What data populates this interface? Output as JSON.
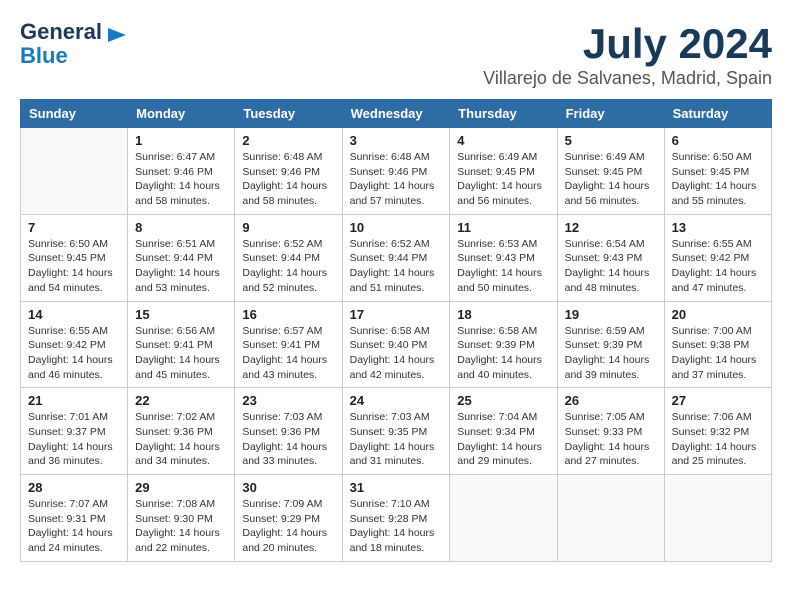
{
  "header": {
    "logo_line1": "General",
    "logo_line2": "Blue",
    "month": "July 2024",
    "location": "Villarejo de Salvanes, Madrid, Spain"
  },
  "weekdays": [
    "Sunday",
    "Monday",
    "Tuesday",
    "Wednesday",
    "Thursday",
    "Friday",
    "Saturday"
  ],
  "weeks": [
    [
      {
        "day": "",
        "sunrise": "",
        "sunset": "",
        "daylight": ""
      },
      {
        "day": "1",
        "sunrise": "Sunrise: 6:47 AM",
        "sunset": "Sunset: 9:46 PM",
        "daylight": "Daylight: 14 hours and 58 minutes."
      },
      {
        "day": "2",
        "sunrise": "Sunrise: 6:48 AM",
        "sunset": "Sunset: 9:46 PM",
        "daylight": "Daylight: 14 hours and 58 minutes."
      },
      {
        "day": "3",
        "sunrise": "Sunrise: 6:48 AM",
        "sunset": "Sunset: 9:46 PM",
        "daylight": "Daylight: 14 hours and 57 minutes."
      },
      {
        "day": "4",
        "sunrise": "Sunrise: 6:49 AM",
        "sunset": "Sunset: 9:45 PM",
        "daylight": "Daylight: 14 hours and 56 minutes."
      },
      {
        "day": "5",
        "sunrise": "Sunrise: 6:49 AM",
        "sunset": "Sunset: 9:45 PM",
        "daylight": "Daylight: 14 hours and 56 minutes."
      },
      {
        "day": "6",
        "sunrise": "Sunrise: 6:50 AM",
        "sunset": "Sunset: 9:45 PM",
        "daylight": "Daylight: 14 hours and 55 minutes."
      }
    ],
    [
      {
        "day": "7",
        "sunrise": "Sunrise: 6:50 AM",
        "sunset": "Sunset: 9:45 PM",
        "daylight": "Daylight: 14 hours and 54 minutes."
      },
      {
        "day": "8",
        "sunrise": "Sunrise: 6:51 AM",
        "sunset": "Sunset: 9:44 PM",
        "daylight": "Daylight: 14 hours and 53 minutes."
      },
      {
        "day": "9",
        "sunrise": "Sunrise: 6:52 AM",
        "sunset": "Sunset: 9:44 PM",
        "daylight": "Daylight: 14 hours and 52 minutes."
      },
      {
        "day": "10",
        "sunrise": "Sunrise: 6:52 AM",
        "sunset": "Sunset: 9:44 PM",
        "daylight": "Daylight: 14 hours and 51 minutes."
      },
      {
        "day": "11",
        "sunrise": "Sunrise: 6:53 AM",
        "sunset": "Sunset: 9:43 PM",
        "daylight": "Daylight: 14 hours and 50 minutes."
      },
      {
        "day": "12",
        "sunrise": "Sunrise: 6:54 AM",
        "sunset": "Sunset: 9:43 PM",
        "daylight": "Daylight: 14 hours and 48 minutes."
      },
      {
        "day": "13",
        "sunrise": "Sunrise: 6:55 AM",
        "sunset": "Sunset: 9:42 PM",
        "daylight": "Daylight: 14 hours and 47 minutes."
      }
    ],
    [
      {
        "day": "14",
        "sunrise": "Sunrise: 6:55 AM",
        "sunset": "Sunset: 9:42 PM",
        "daylight": "Daylight: 14 hours and 46 minutes."
      },
      {
        "day": "15",
        "sunrise": "Sunrise: 6:56 AM",
        "sunset": "Sunset: 9:41 PM",
        "daylight": "Daylight: 14 hours and 45 minutes."
      },
      {
        "day": "16",
        "sunrise": "Sunrise: 6:57 AM",
        "sunset": "Sunset: 9:41 PM",
        "daylight": "Daylight: 14 hours and 43 minutes."
      },
      {
        "day": "17",
        "sunrise": "Sunrise: 6:58 AM",
        "sunset": "Sunset: 9:40 PM",
        "daylight": "Daylight: 14 hours and 42 minutes."
      },
      {
        "day": "18",
        "sunrise": "Sunrise: 6:58 AM",
        "sunset": "Sunset: 9:39 PM",
        "daylight": "Daylight: 14 hours and 40 minutes."
      },
      {
        "day": "19",
        "sunrise": "Sunrise: 6:59 AM",
        "sunset": "Sunset: 9:39 PM",
        "daylight": "Daylight: 14 hours and 39 minutes."
      },
      {
        "day": "20",
        "sunrise": "Sunrise: 7:00 AM",
        "sunset": "Sunset: 9:38 PM",
        "daylight": "Daylight: 14 hours and 37 minutes."
      }
    ],
    [
      {
        "day": "21",
        "sunrise": "Sunrise: 7:01 AM",
        "sunset": "Sunset: 9:37 PM",
        "daylight": "Daylight: 14 hours and 36 minutes."
      },
      {
        "day": "22",
        "sunrise": "Sunrise: 7:02 AM",
        "sunset": "Sunset: 9:36 PM",
        "daylight": "Daylight: 14 hours and 34 minutes."
      },
      {
        "day": "23",
        "sunrise": "Sunrise: 7:03 AM",
        "sunset": "Sunset: 9:36 PM",
        "daylight": "Daylight: 14 hours and 33 minutes."
      },
      {
        "day": "24",
        "sunrise": "Sunrise: 7:03 AM",
        "sunset": "Sunset: 9:35 PM",
        "daylight": "Daylight: 14 hours and 31 minutes."
      },
      {
        "day": "25",
        "sunrise": "Sunrise: 7:04 AM",
        "sunset": "Sunset: 9:34 PM",
        "daylight": "Daylight: 14 hours and 29 minutes."
      },
      {
        "day": "26",
        "sunrise": "Sunrise: 7:05 AM",
        "sunset": "Sunset: 9:33 PM",
        "daylight": "Daylight: 14 hours and 27 minutes."
      },
      {
        "day": "27",
        "sunrise": "Sunrise: 7:06 AM",
        "sunset": "Sunset: 9:32 PM",
        "daylight": "Daylight: 14 hours and 25 minutes."
      }
    ],
    [
      {
        "day": "28",
        "sunrise": "Sunrise: 7:07 AM",
        "sunset": "Sunset: 9:31 PM",
        "daylight": "Daylight: 14 hours and 24 minutes."
      },
      {
        "day": "29",
        "sunrise": "Sunrise: 7:08 AM",
        "sunset": "Sunset: 9:30 PM",
        "daylight": "Daylight: 14 hours and 22 minutes."
      },
      {
        "day": "30",
        "sunrise": "Sunrise: 7:09 AM",
        "sunset": "Sunset: 9:29 PM",
        "daylight": "Daylight: 14 hours and 20 minutes."
      },
      {
        "day": "31",
        "sunrise": "Sunrise: 7:10 AM",
        "sunset": "Sunset: 9:28 PM",
        "daylight": "Daylight: 14 hours and 18 minutes."
      },
      {
        "day": "",
        "sunrise": "",
        "sunset": "",
        "daylight": ""
      },
      {
        "day": "",
        "sunrise": "",
        "sunset": "",
        "daylight": ""
      },
      {
        "day": "",
        "sunrise": "",
        "sunset": "",
        "daylight": ""
      }
    ]
  ]
}
